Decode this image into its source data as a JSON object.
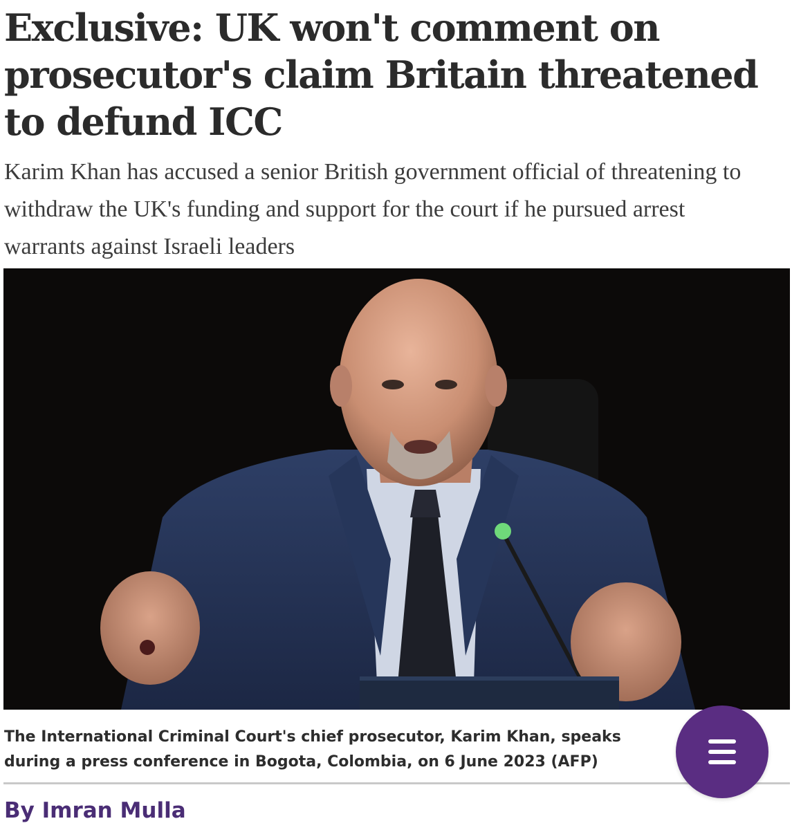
{
  "article": {
    "headline": "Exclusive: UK won't comment on prosecutor's claim Britain threatened to defund ICC",
    "standfirst": "Karim Khan has accused a senior British government official of threatening to withdraw the UK's funding and support for the court if he pursued arrest warrants against Israeli leaders",
    "image": {
      "caption": "The International Criminal Court's chief prosecutor, Karim Khan, speaks during a press conference in Bogota, Colombia, on 6 June 2023 (AFP)"
    },
    "byline": {
      "prefix": "By",
      "author": "Imran Mulla"
    }
  },
  "menu": {
    "icon": "hamburger-menu-icon"
  },
  "colors": {
    "headline": "#2b2b2b",
    "byline": "#4a2d75",
    "menu_button": "#5a2d82",
    "photo_background": "#0c0a09"
  }
}
